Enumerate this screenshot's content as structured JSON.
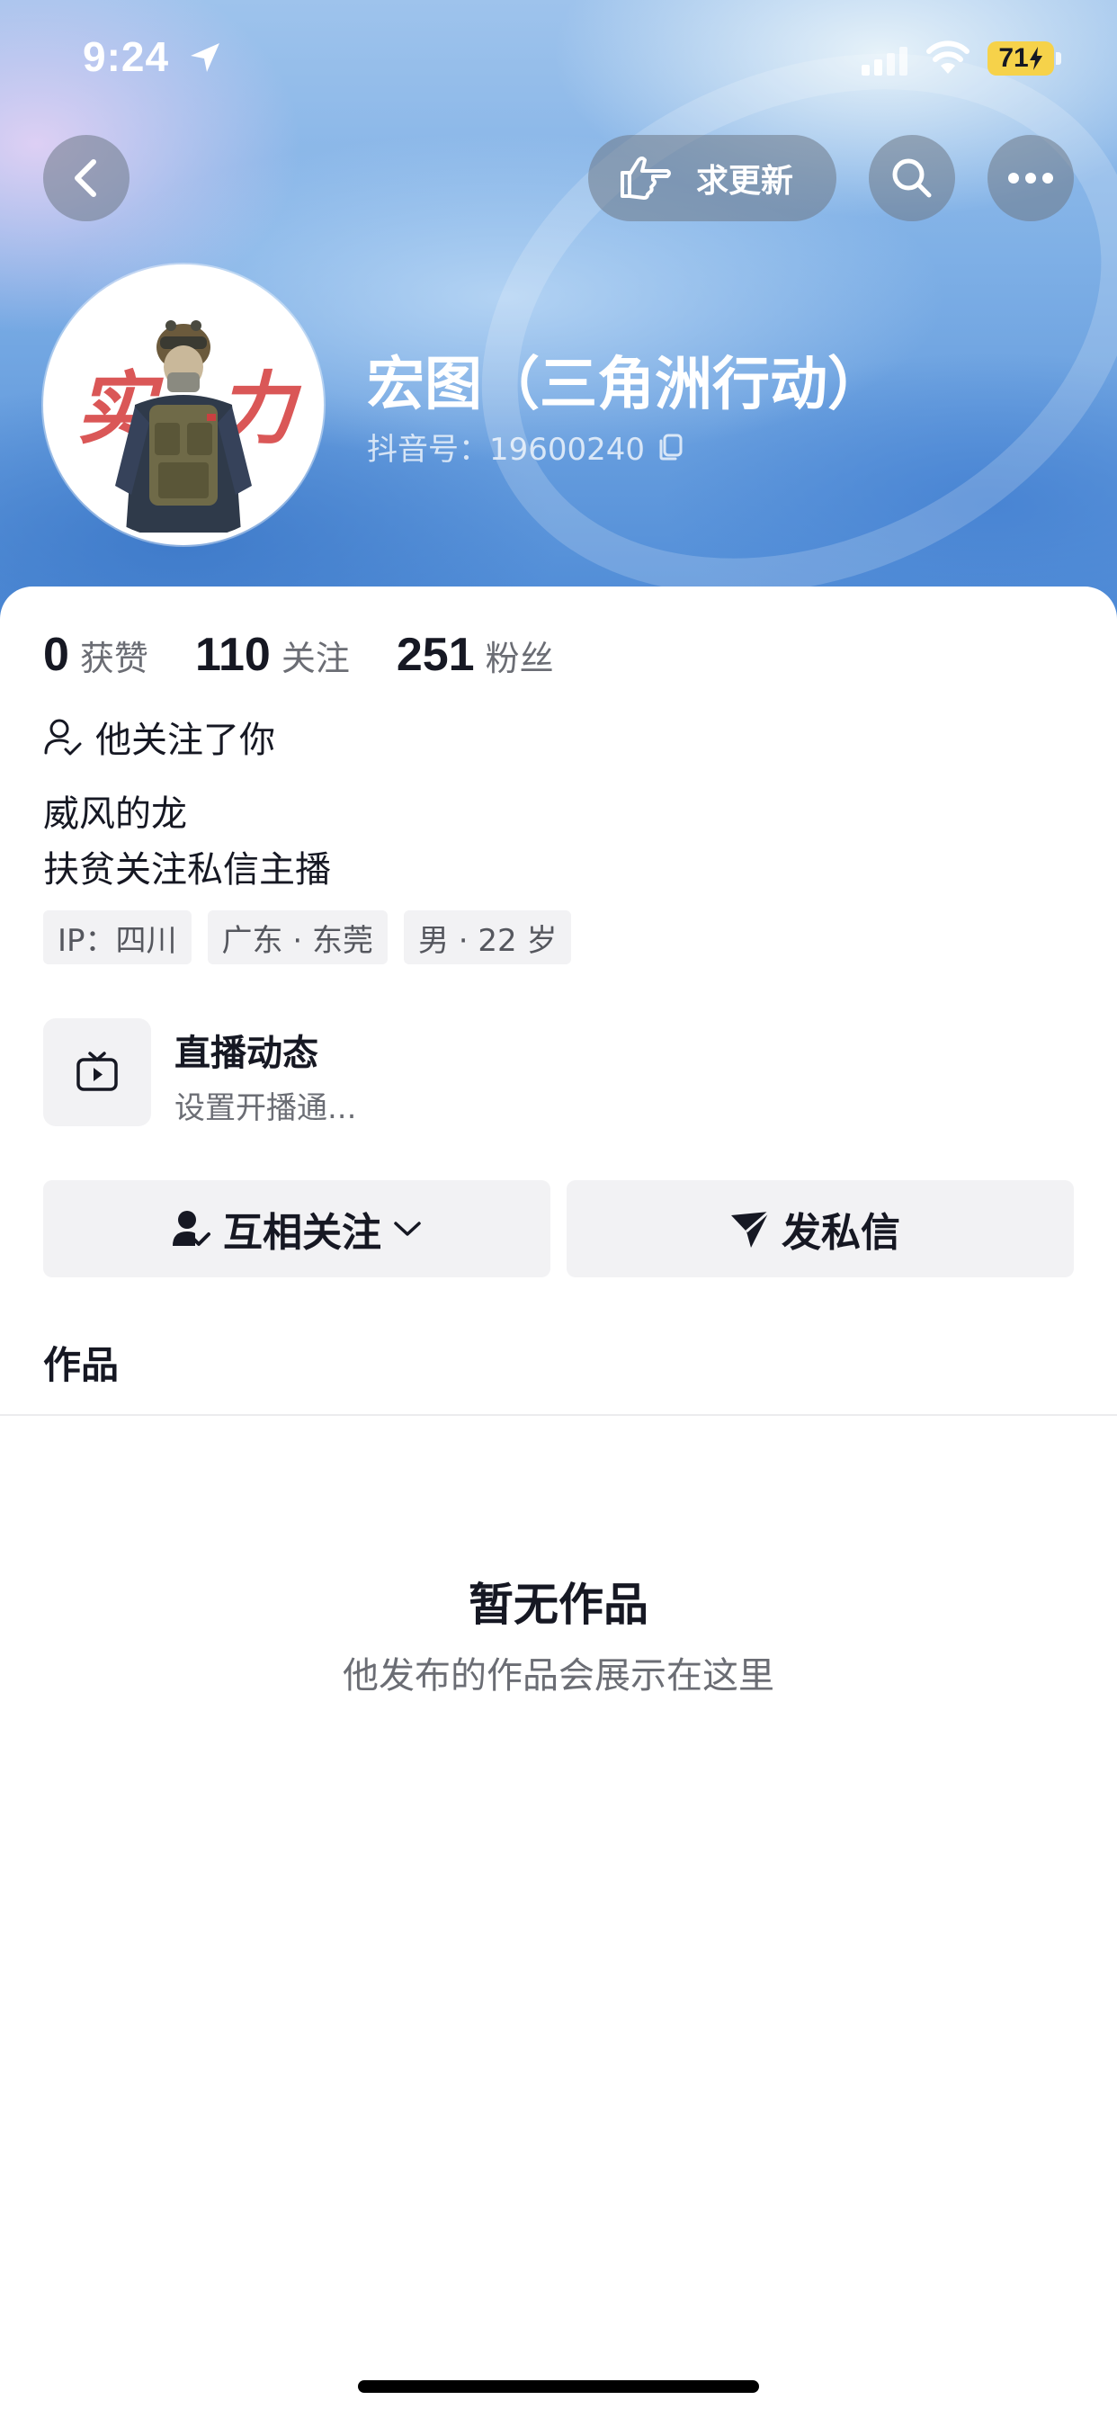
{
  "status_bar": {
    "time": "9:24",
    "battery": "71",
    "icons": [
      "location-arrow-icon",
      "signal-icon",
      "wifi-icon",
      "battery-charging-icon"
    ]
  },
  "header": {
    "back_icon": "chevron-left-icon",
    "request_update_label": "求更新",
    "request_update_icon": "pointing-hand-icon",
    "search_icon": "search-icon",
    "more_icon": "more-dots-icon"
  },
  "profile": {
    "name": "宏图（三角洲行动）",
    "douyin_id": "抖音号：19600240",
    "avatar_text_left": "实",
    "avatar_text_right": "力"
  },
  "stats": [
    {
      "value": "0",
      "label": "获赞"
    },
    {
      "value": "110",
      "label": "关注"
    },
    {
      "value": "251",
      "label": "粉丝"
    }
  ],
  "follows_you": "他关注了你",
  "bio": [
    "威风的龙",
    "扶贫关注私信主播"
  ],
  "tags": [
    "IP：四川",
    "广东 · 东莞",
    "男 · 22 岁"
  ],
  "live": {
    "title": "直播动态",
    "subtitle": "设置开播通..."
  },
  "actions": {
    "mutual_follow": "互相关注",
    "message": "发私信"
  },
  "works_tab": "作品",
  "empty": {
    "title": "暂无作品",
    "subtitle": "他发布的作品会展示在这里"
  },
  "colors": {
    "accent_battery": "#f6d24a",
    "text_primary": "#161823",
    "text_secondary": "#6b6d74",
    "button_bg": "#f2f2f4"
  }
}
